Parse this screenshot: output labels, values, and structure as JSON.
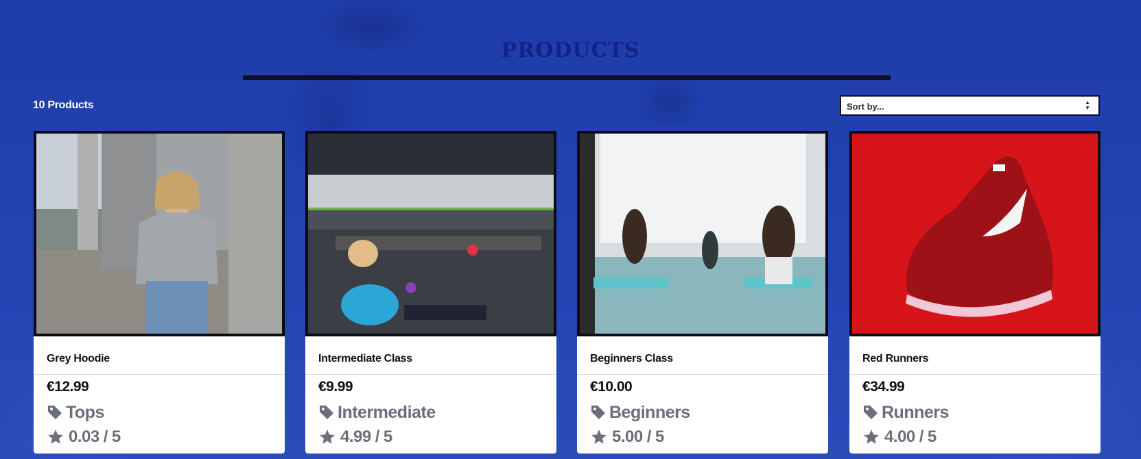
{
  "page": {
    "title": "PRODUCTS",
    "product_count": "10 Products",
    "sort": {
      "selected": "Sort by..."
    }
  },
  "colors": {
    "background": "#1f3fae",
    "title": "#13228a",
    "rule": "#0c0f25",
    "meta_text": "#6b6f7a"
  },
  "products": [
    {
      "name": "Grey Hoodie",
      "price": "€12.99",
      "category": "Tops",
      "rating": "0.03",
      "rating_max": "5",
      "image": "woman-in-grey-hoodie-photo"
    },
    {
      "name": "Intermediate Class",
      "price": "€9.99",
      "category": "Intermediate",
      "rating": "4.99",
      "rating_max": "5",
      "image": "gym-class-photo"
    },
    {
      "name": "Beginners Class",
      "price": "€10.00",
      "category": "Beginners",
      "rating": "5.00",
      "rating_max": "5",
      "image": "yoga-class-photo"
    },
    {
      "name": "Red Runners",
      "price": "€34.99",
      "category": "Runners",
      "rating": "4.00",
      "rating_max": "5",
      "image": "red-running-shoe-photo"
    }
  ]
}
